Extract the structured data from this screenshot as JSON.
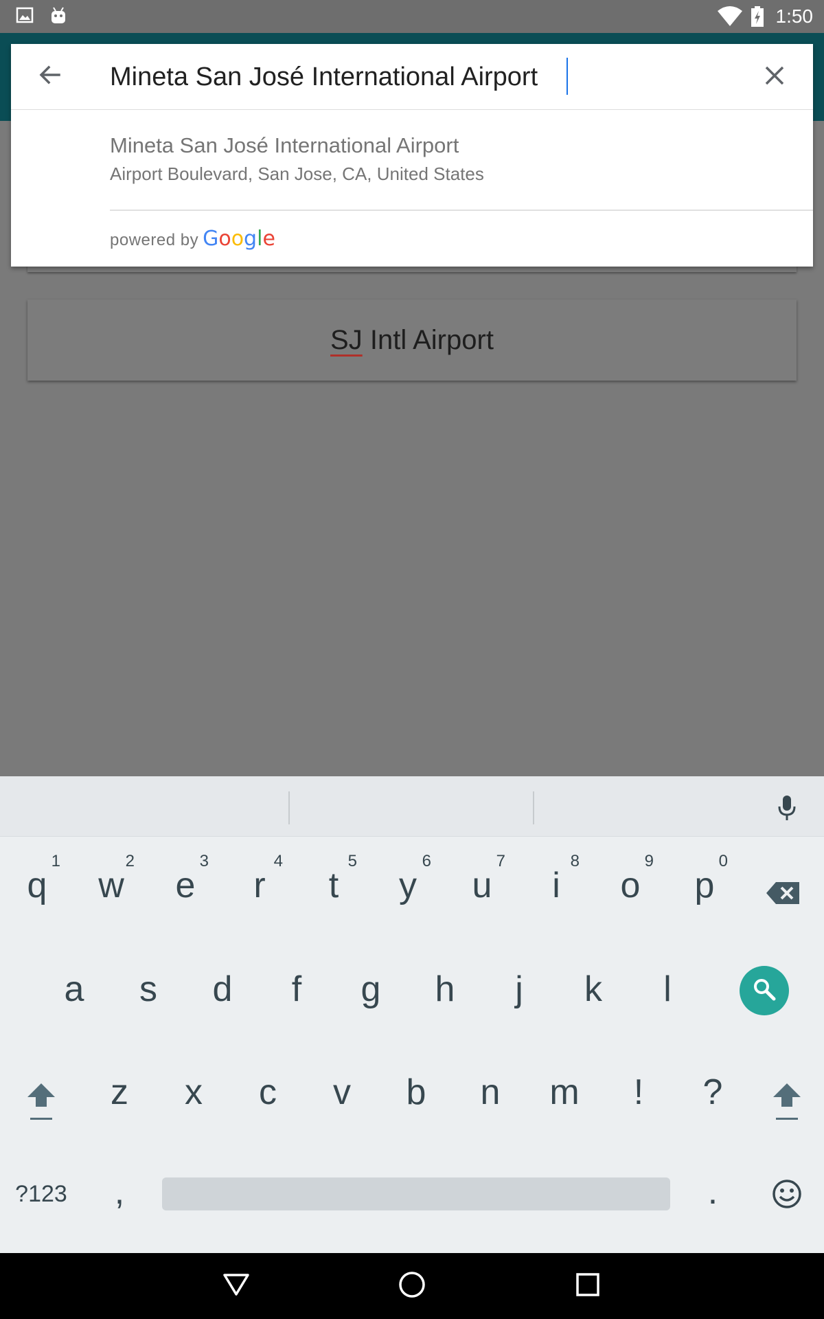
{
  "status_bar": {
    "time": "1:50",
    "icons": [
      "image-icon",
      "android-icon",
      "wifi-icon",
      "battery-charging-icon"
    ]
  },
  "background": {
    "button_label_underlined": "SJ",
    "button_label_rest": " Intl Airport"
  },
  "search": {
    "query": "Mineta San José International Airport",
    "back_icon": "arrow-back-icon",
    "clear_icon": "close-icon",
    "suggestions": [
      {
        "title": "Mineta San José International Airport",
        "subtitle": "Airport Boulevard, San Jose, CA, United States"
      }
    ],
    "attribution_prefix": "powered by",
    "attribution_brand": [
      "G",
      "o",
      "o",
      "g",
      "l",
      "e"
    ],
    "brand_colors": [
      "#4285F4",
      "#EA4335",
      "#FBBC05",
      "#4285F4",
      "#34A853",
      "#EA4335"
    ]
  },
  "keyboard": {
    "row1": [
      {
        "key": "q",
        "num": "1"
      },
      {
        "key": "w",
        "num": "2"
      },
      {
        "key": "e",
        "num": "3"
      },
      {
        "key": "r",
        "num": "4"
      },
      {
        "key": "t",
        "num": "5"
      },
      {
        "key": "y",
        "num": "6"
      },
      {
        "key": "u",
        "num": "7"
      },
      {
        "key": "i",
        "num": "8"
      },
      {
        "key": "o",
        "num": "9"
      },
      {
        "key": "p",
        "num": "0"
      }
    ],
    "row2": [
      "a",
      "s",
      "d",
      "f",
      "g",
      "h",
      "j",
      "k",
      "l"
    ],
    "row3": [
      "z",
      "x",
      "c",
      "v",
      "b",
      "n",
      "m",
      "!",
      "?"
    ],
    "symbols_key": "?123",
    "comma_key": ",",
    "period_key": ".",
    "action_color": "#26A69A"
  },
  "nav_bar": {
    "buttons": [
      "back-triangle-icon",
      "home-circle-icon",
      "recents-square-icon"
    ]
  }
}
